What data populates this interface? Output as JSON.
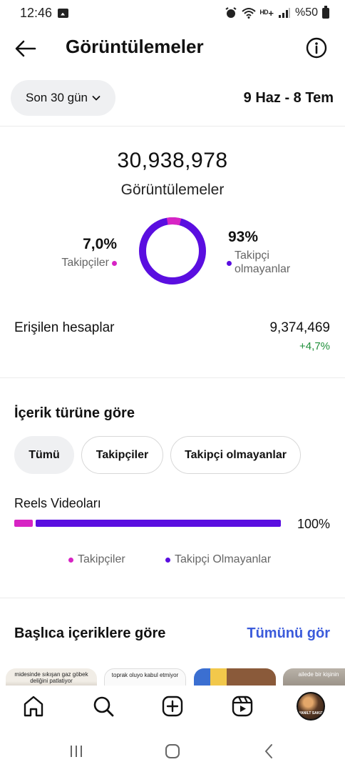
{
  "status_bar": {
    "time": "12:46",
    "network": "ᴴᴰ+",
    "battery": "%50"
  },
  "header": {
    "title": "Görüntülemeler",
    "back_icon": "arrow-left-icon",
    "info_icon": "info-circle-icon"
  },
  "filter": {
    "range_label": "Son 30 gün",
    "date_range": "9 Haz - 8 Tem"
  },
  "summary": {
    "total_views": "30,938,978",
    "total_label": "Görüntülemeler",
    "followers_percent": "7,0%",
    "followers_label": "Takipçiler",
    "non_followers_percent": "93%",
    "non_followers_label": "Takipçi olmayanlar",
    "followers_share": 0.07
  },
  "reached": {
    "label": "Erişilen hesaplar",
    "value": "9,374,469",
    "change": "+4,7%"
  },
  "content_type": {
    "title": "İçerik türüne göre",
    "tabs": [
      "Tümü",
      "Takipçiler",
      "Takipçi olmayanlar"
    ],
    "active_tab": 0,
    "item_label": "Reels Videoları",
    "item_percent": "100%",
    "item_followers_share": 0.07,
    "legend_followers": "Takipçiler",
    "legend_non_followers": "Takipçi Olmayanlar"
  },
  "top_content": {
    "title": "Başlıca içeriklere göre",
    "see_all": "Tümünü gör",
    "thumbs": [
      {
        "caption": "midesinde sıkışan gaz göbek deliğini patlatiyor"
      },
      {
        "caption": "toprak oluyo kabul etmiyor"
      },
      {
        "caption": ""
      },
      {
        "caption": "ailede bir kişinin"
      }
    ]
  },
  "bottom_nav": {
    "items": [
      "home-icon",
      "search-icon",
      "create-icon",
      "reels-icon",
      "profile-avatar"
    ],
    "avatar_text": "YANILT SAKIZ"
  },
  "colors": {
    "followers": "#d724c4",
    "non_followers": "#5a0ee0",
    "positive": "#1f8f3a",
    "link": "#3b5bdb",
    "chip_bg": "#eff0f2"
  }
}
